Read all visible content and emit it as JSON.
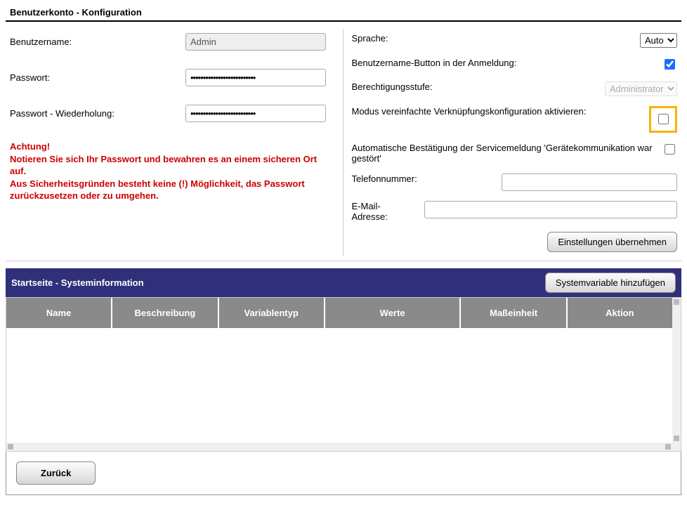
{
  "section_title": "Benutzerkonto - Konfiguration",
  "left": {
    "username_label": "Benutzername:",
    "username_value": "Admin",
    "password_label": "Passwort:",
    "password_value": "••••••••••••••••••••••••••",
    "password_repeat_label": "Passwort - Wiederholung:",
    "password_repeat_value": "••••••••••••••••••••••••••",
    "warning": {
      "line1": "Achtung!",
      "line2": "Notieren Sie sich Ihr Passwort und bewahren es an einem sicheren Ort auf.",
      "line3": "Aus Sicherheitsgründen besteht keine (!) Möglichkeit, das Passwort zurückzusetzen oder zu umgehen."
    }
  },
  "right": {
    "language_label": "Sprache:",
    "language_value": "Auto",
    "username_button_label": "Benutzername-Button in der Anmeldung:",
    "username_button_checked": true,
    "permission_label": "Berechtigungsstufe:",
    "permission_value": "Administrator",
    "simplified_mode_label": "Modus vereinfachte Verknüpfungskonfiguration aktivieren:",
    "simplified_mode_checked": false,
    "auto_confirm_label": "Automatische Bestätigung der Servicemeldung 'Gerätekommunikation war gestört'",
    "auto_confirm_checked": false,
    "phone_label": "Telefonnummer:",
    "phone_value": "",
    "email_label": "E-Mail-Adresse:",
    "email_value": "",
    "apply_button": "Einstellungen übernehmen"
  },
  "panel": {
    "title": "Startseite - Systeminformation",
    "add_button": "Systemvariable hinzufügen",
    "columns": [
      "Name",
      "Beschreibung",
      "Variablentyp",
      "Werte",
      "Maßeinheit",
      "Aktion"
    ]
  },
  "footer": {
    "back_button": "Zurück"
  }
}
